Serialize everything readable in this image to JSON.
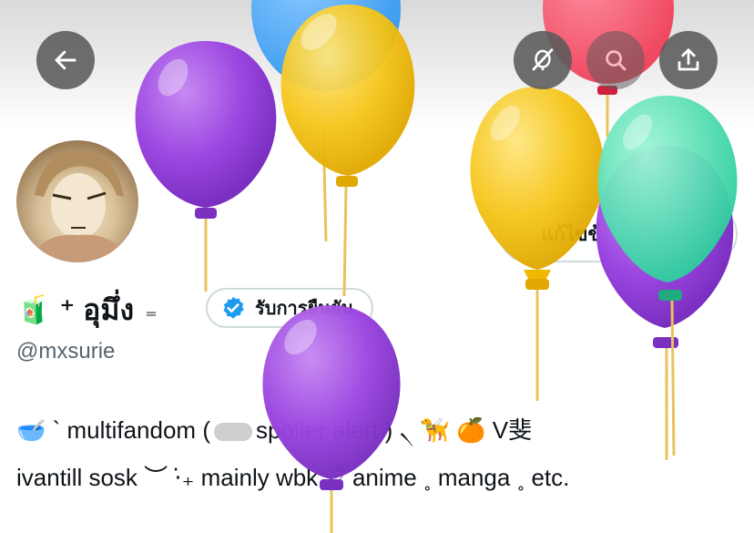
{
  "header": {
    "back_icon": "arrow-left-icon",
    "icons": [
      "balloon-off-icon",
      "search-icon",
      "share-icon"
    ]
  },
  "profile": {
    "edit_label": "แก้ไขข้อมูลส่วนตัว",
    "name_prefix_emoji": "🧃",
    "name": "⁺ อุมึ่ง",
    "name_suffix": "₌",
    "verify_label": "รับการยืนยัน",
    "handle": "@mxsurie"
  },
  "bio": {
    "line1_a": "🥣 ` multifandom (",
    "line1_b": "spoiler alert ) ৲ 🦮 🍊 V斐",
    "line2": "ivantill sosk ︶ ⋅̇₊ mainly wbk ♡̆̈ anime ˳ manga ˳ etc."
  },
  "colors": {
    "purple": "#9b45e0",
    "yellow": "#f5c518",
    "blue": "#3b9cf0",
    "red": "#f0405a",
    "teal": "#3ee0b0",
    "verify_blue": "#1d9bf0"
  }
}
